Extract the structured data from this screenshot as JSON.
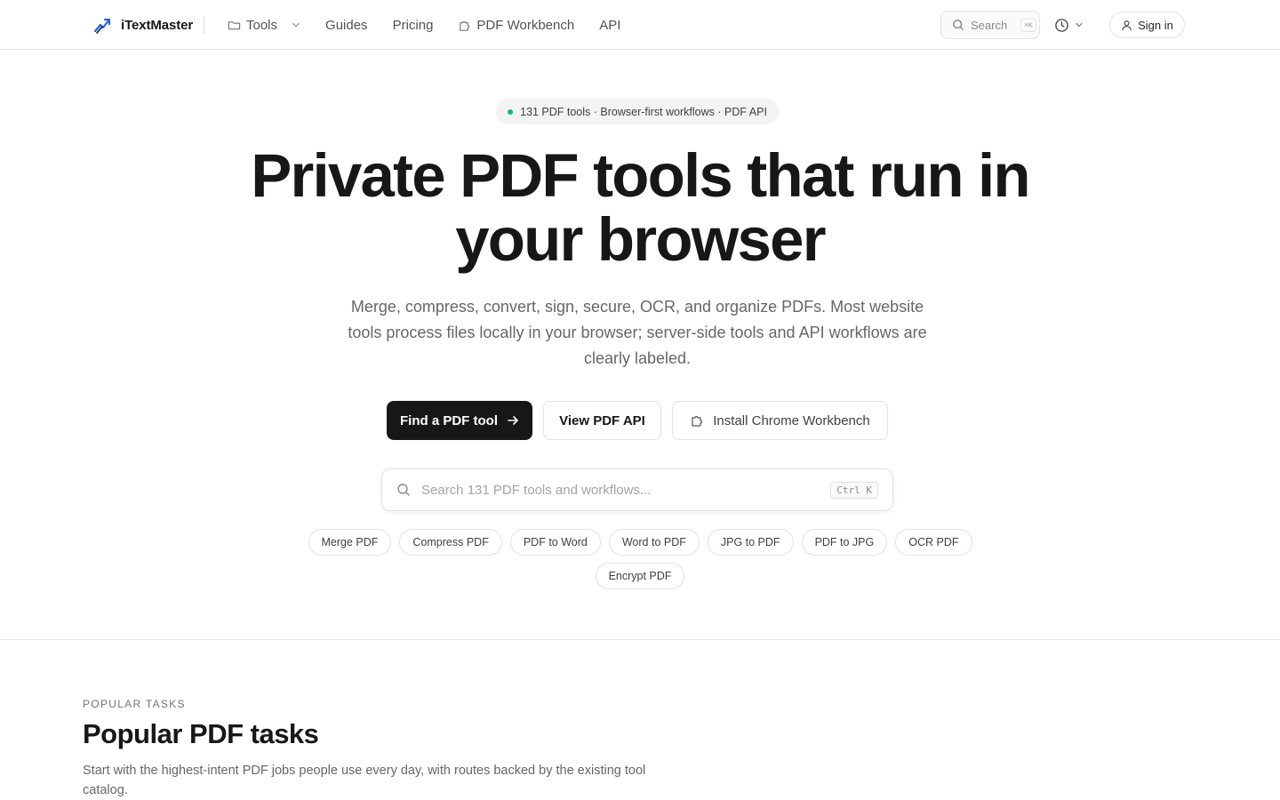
{
  "header": {
    "brand": "iTextMaster",
    "nav": {
      "tools": "Tools",
      "guides": "Guides",
      "pricing": "Pricing",
      "workbench": "PDF Workbench",
      "api": "API"
    },
    "search_label": "Search",
    "search_shortcut": "⌘K",
    "signin": "Sign in"
  },
  "hero": {
    "badge": "131 PDF tools · Browser-first workflows · PDF API",
    "title": "Private PDF tools that run in your browser",
    "subtitle": "Merge, compress, convert, sign, secure, OCR, and organize PDFs. Most website tools process files locally in your browser; server-side tools and API workflows are clearly labeled.",
    "cta_primary": "Find a PDF tool",
    "cta_secondary": "View PDF API",
    "cta_tertiary": "Install Chrome Workbench",
    "search_placeholder": "Search 131 PDF tools and workflows...",
    "search_shortcut": "Ctrl K",
    "chips": [
      "Merge PDF",
      "Compress PDF",
      "PDF to Word",
      "Word to PDF",
      "JPG to PDF",
      "PDF to JPG",
      "OCR PDF",
      "Encrypt PDF"
    ]
  },
  "popular": {
    "eyebrow": "POPULAR TASKS",
    "title": "Popular PDF tasks",
    "description": "Start with the highest-intent PDF jobs people use every day, with routes backed by the existing tool catalog."
  },
  "colors": {
    "accent": "#171717",
    "status_dot": "#10b981",
    "logo_primary": "#2563eb"
  }
}
